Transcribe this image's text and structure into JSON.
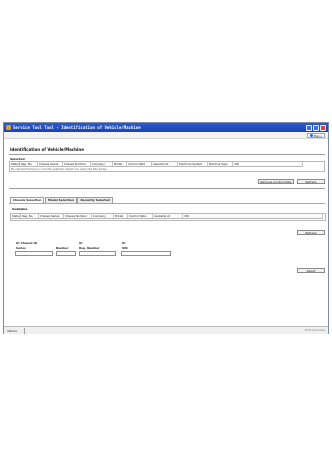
{
  "window": {
    "title": "Service Tool Tool - Identification of Vehicle/Machine"
  },
  "menubar": {
    "help_label": "Menu"
  },
  "page": {
    "heading": "Identification of Vehicle/Machine"
  },
  "selected": {
    "label": "Selected",
    "columns": [
      "Status",
      "Reg. No.",
      "Chassis Series",
      "Chassis Number",
      "Company",
      "Model",
      "Control Data",
      "Selected At",
      "Electrical System",
      "Machine Type",
      "VIN"
    ],
    "empty_message": "No vehicle/machine is currently selected. Select one using the lists below.",
    "remove_button": "Remove Control Data",
    "refresh_button": "Refresh"
  },
  "tabs": [
    {
      "label": "Chassis Selection",
      "active": true
    },
    {
      "label": "Model Selection",
      "active": false
    },
    {
      "label": "Recently Selected",
      "active": false
    }
  ],
  "available": {
    "label": "Available",
    "columns": [
      "Status",
      "Reg. No.",
      "Chassis Series",
      "Chassis Number",
      "Company",
      "Model",
      "Control Data",
      "Available At",
      "VIN"
    ],
    "refresh_button": "Refresh"
  },
  "search": {
    "chassis_id_label": "Or Chassis ID",
    "series_label": "Series",
    "number_label": "Number",
    "or1_label": "Or",
    "reg_label": "Reg. Number",
    "or2_label": "Or",
    "vin_label": "VIN",
    "series_value": "",
    "number_value": "",
    "reg_value": "",
    "vin_value": "",
    "select_button": "Select"
  },
  "statusbar": {
    "left": "Vehicle",
    "right": "TC Environment"
  }
}
